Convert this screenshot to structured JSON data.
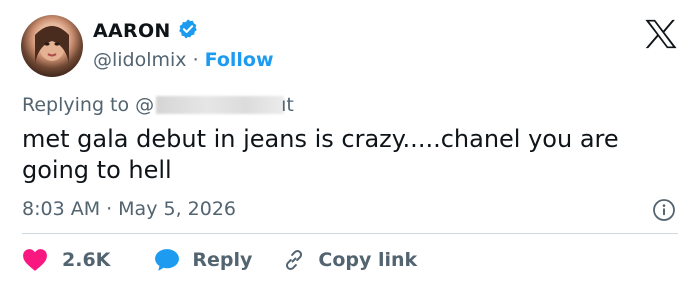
{
  "header": {
    "name": "AARON",
    "handle": "@lidolmix",
    "separator": "·",
    "follow_label": "Follow",
    "verified": true
  },
  "reply_context": {
    "label": "Replying to",
    "mention_prefix": "@",
    "mention_tail": "ıt"
  },
  "tweet": {
    "text": "met gala debut in jeans is crazy.....chanel you are going to hell"
  },
  "meta": {
    "time": "8:03 AM",
    "separator": "·",
    "date": "May 5, 2026"
  },
  "actions": {
    "like_count": "2.6K",
    "reply_label": "Reply",
    "copy_label": "Copy link"
  },
  "colors": {
    "accent": "#1d9bf0",
    "like": "#f91880",
    "text": "#0f1419",
    "secondary": "#536471",
    "divider": "#cfd9de"
  },
  "icons": {
    "verified": "verified-badge-icon",
    "logo": "x-logo-icon",
    "info": "info-icon",
    "like": "heart-icon",
    "reply": "speech-bubble-icon",
    "copy": "link-icon"
  }
}
